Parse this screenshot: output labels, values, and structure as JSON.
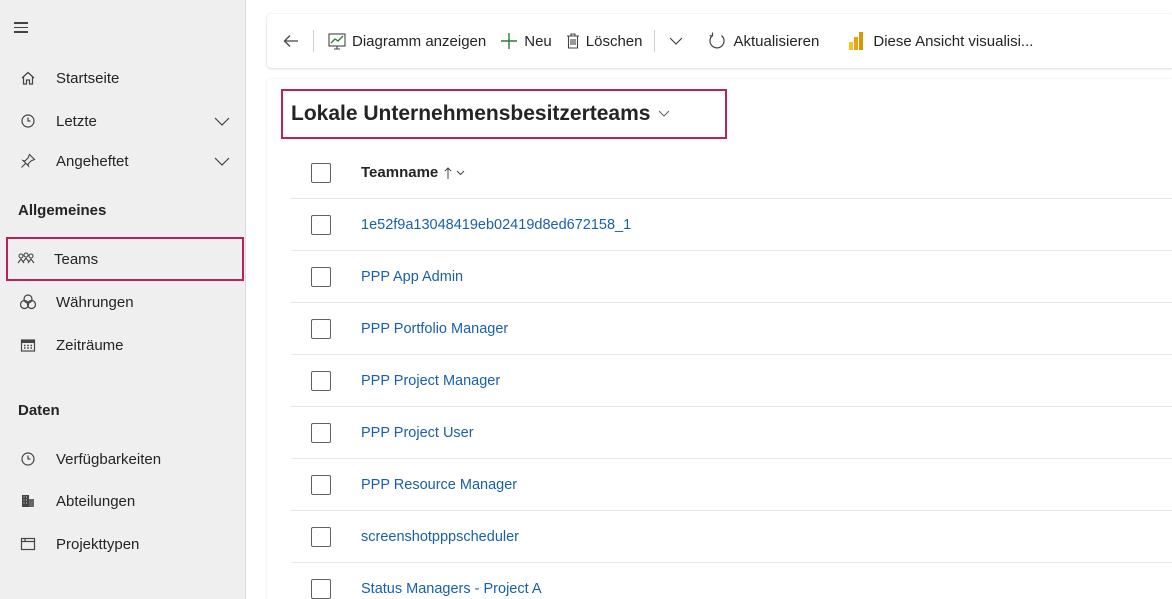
{
  "sidebar": {
    "items": [
      {
        "label": "Startseite"
      },
      {
        "label": "Letzte"
      },
      {
        "label": "Angeheftet"
      }
    ],
    "sections": [
      {
        "title": "Allgemeines",
        "items": [
          {
            "label": "Teams",
            "selected": true
          },
          {
            "label": "Währungen"
          },
          {
            "label": "Zeiträume"
          }
        ]
      },
      {
        "title": "Daten",
        "items": [
          {
            "label": "Verfügbarkeiten"
          },
          {
            "label": "Abteilungen"
          },
          {
            "label": "Projekttypen"
          }
        ]
      }
    ]
  },
  "toolbar": {
    "show_chart": "Diagramm anzeigen",
    "new": "Neu",
    "delete": "Löschen",
    "refresh": "Aktualisieren",
    "visualize": "Diese Ansicht visualisi..."
  },
  "view": {
    "title": "Lokale Unternehmensbesitzerteams"
  },
  "grid": {
    "column_header": "Teamname",
    "rows": [
      "1e52f9a13048419eb02419d8ed672158_1",
      "PPP App Admin",
      "PPP Portfolio Manager",
      "PPP Project Manager",
      "PPP Project User",
      "PPP Resource Manager",
      "screenshotpppscheduler",
      "Status Managers - Project A"
    ]
  },
  "colors": {
    "accent_highlight": "#b5235c",
    "link": "#1a5fab",
    "sidebar_bg": "#efefef"
  }
}
